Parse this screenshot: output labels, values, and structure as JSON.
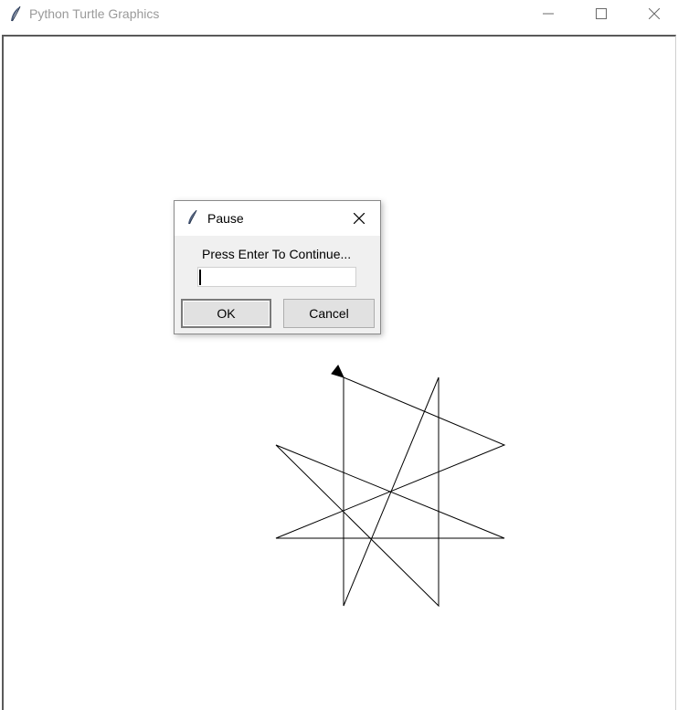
{
  "window": {
    "title": "Python Turtle Graphics",
    "controls": [
      "minimize-icon",
      "maximize-icon",
      "close-icon"
    ]
  },
  "dialog": {
    "title": "Pause",
    "prompt": "Press Enter To Continue...",
    "input_value": "",
    "ok_label": "OK",
    "cancel_label": "Cancel"
  },
  "colors": {
    "title_text": "#9a9a9a",
    "dialog_bg": "#f0f0f0",
    "pen": "#000000"
  }
}
